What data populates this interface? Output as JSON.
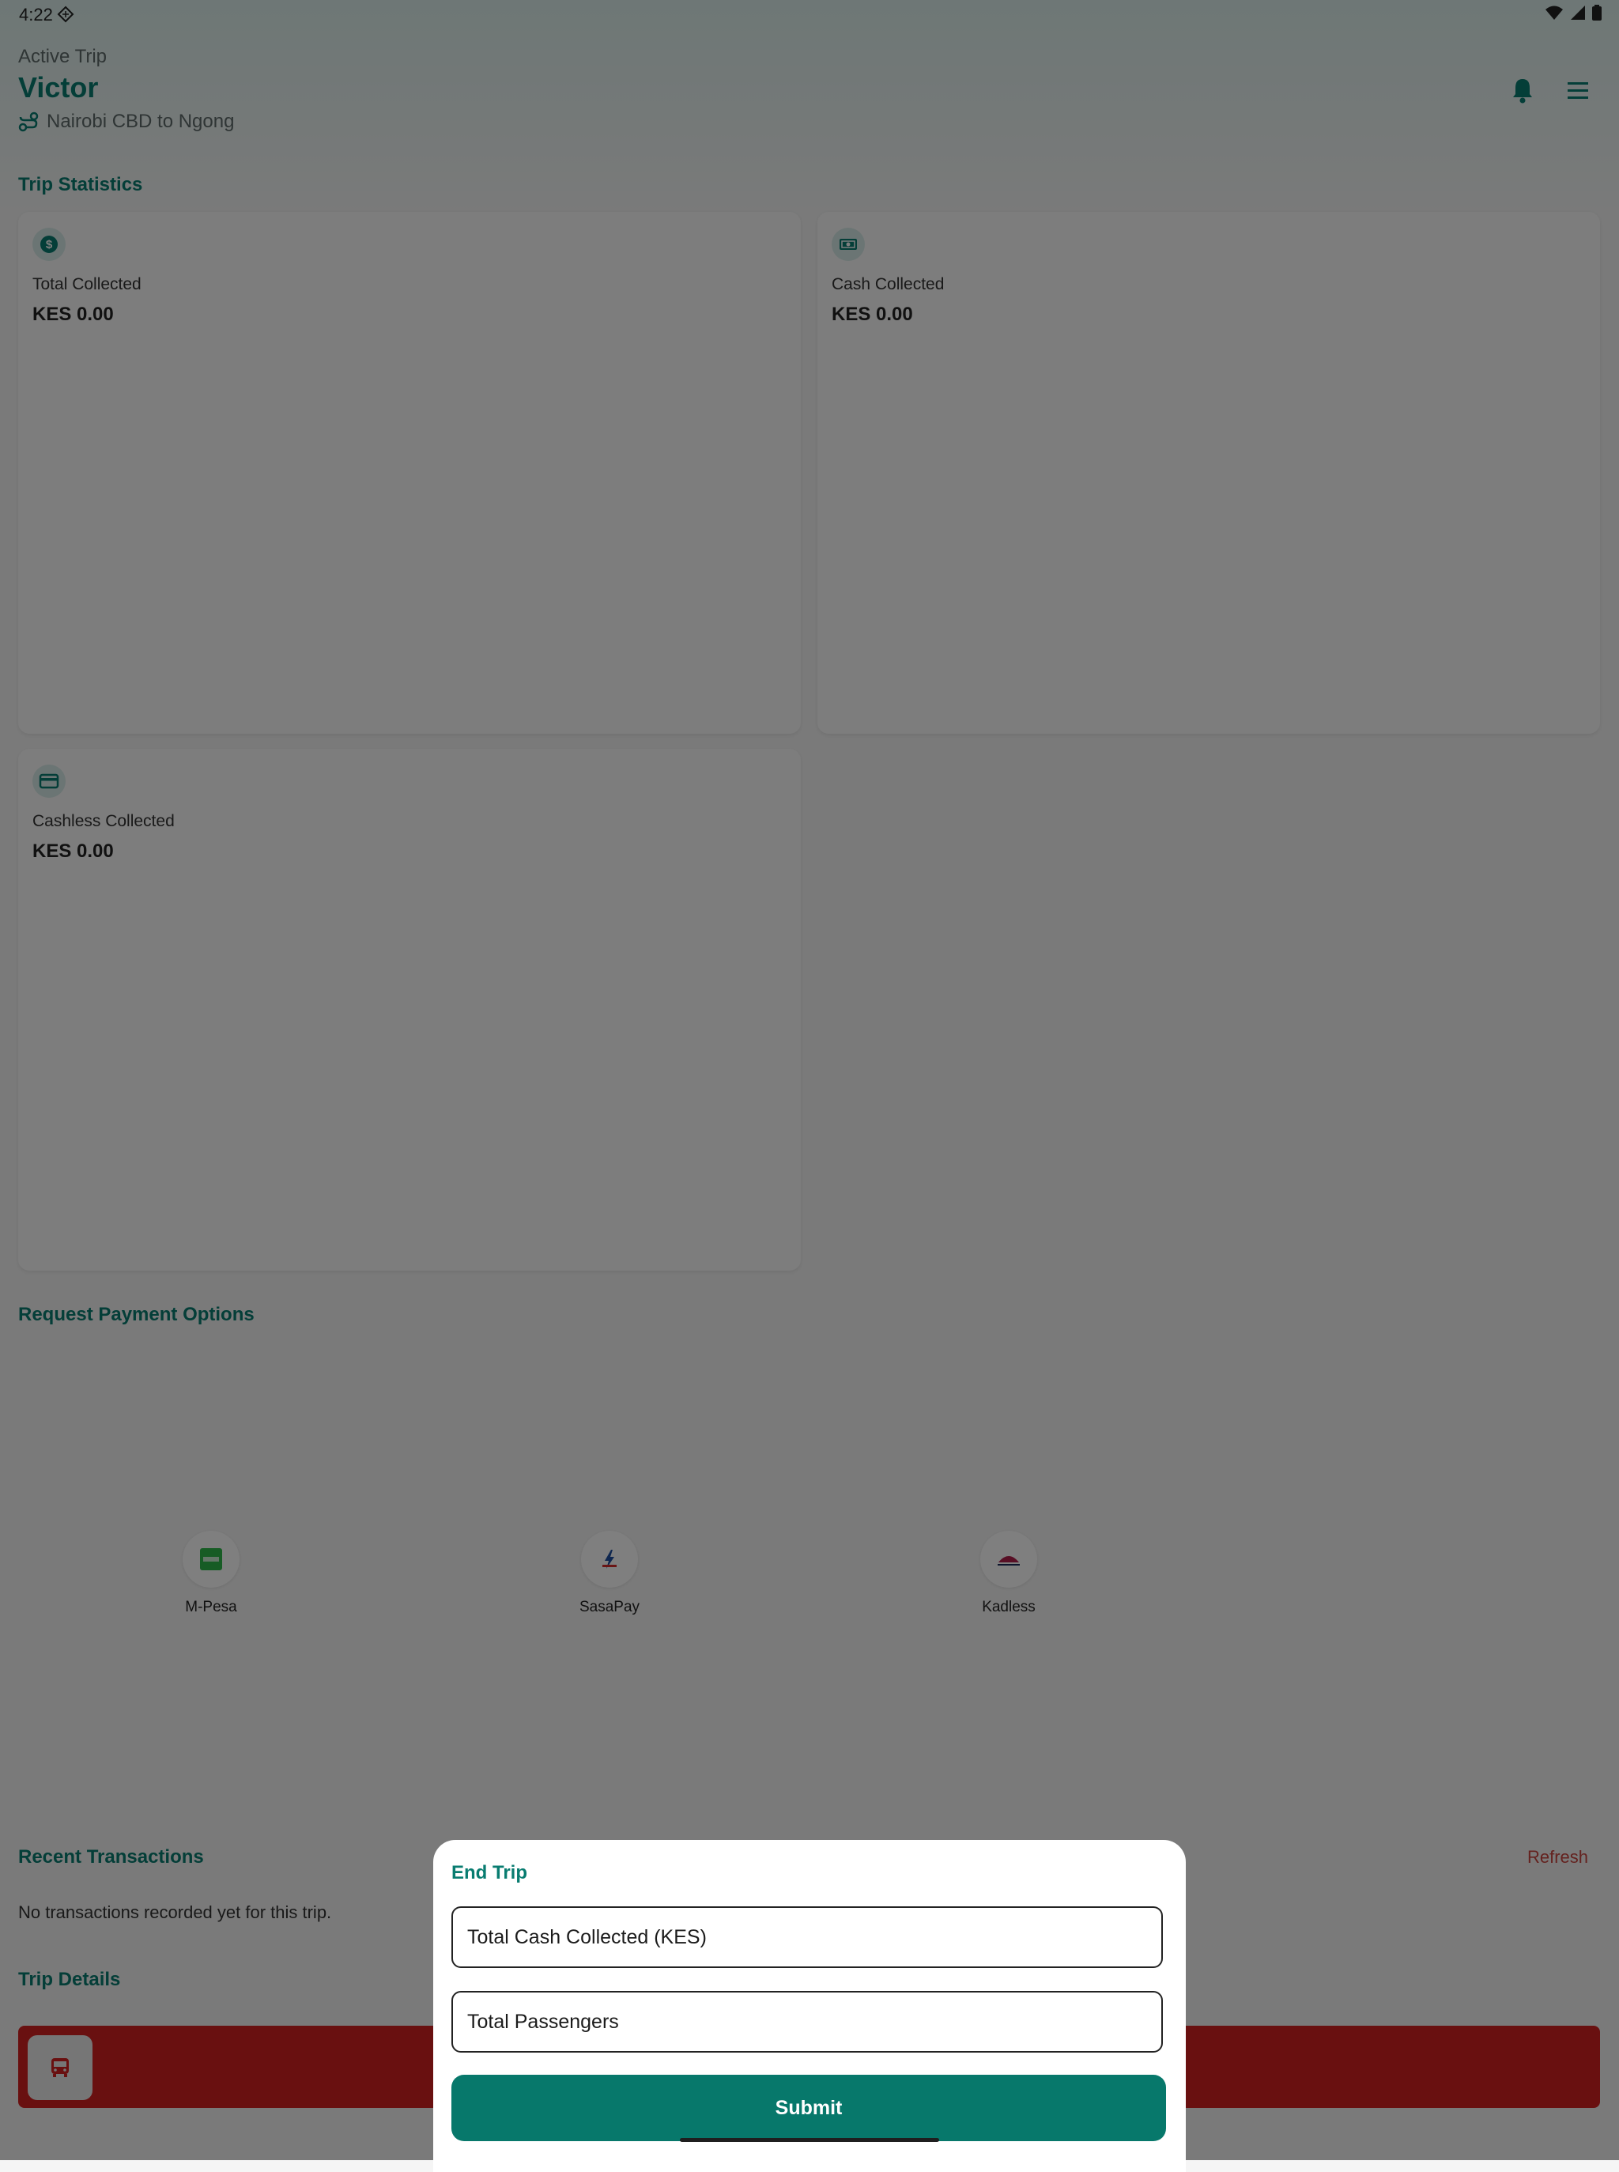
{
  "status_bar": {
    "time": "4:22"
  },
  "header": {
    "eyebrow": "Active Trip",
    "title": "Victor",
    "route": "Nairobi CBD to Ngong"
  },
  "stats": {
    "section_title": "Trip Statistics",
    "cards": [
      {
        "label": "Total Collected",
        "value": "KES 0.00",
        "icon": "dollar-circle-icon"
      },
      {
        "label": "Cash Collected",
        "value": "KES 0.00",
        "icon": "banknote-icon"
      },
      {
        "label": "Cashless Collected",
        "value": "KES 0.00",
        "icon": "credit-card-icon"
      }
    ]
  },
  "payment_options": {
    "section_title": "Request Payment Options",
    "items": [
      {
        "label": "M-Pesa",
        "icon": "mpesa-logo"
      },
      {
        "label": "SasaPay",
        "icon": "sasapay-logo"
      },
      {
        "label": "Kadless",
        "icon": "kadless-logo"
      }
    ]
  },
  "transactions": {
    "section_title": "Recent Transactions",
    "refresh_label": "Refresh",
    "empty_text": "No transactions recorded yet for this trip."
  },
  "trip_details": {
    "section_title": "Trip Details"
  },
  "end_trip_sheet": {
    "title": "End Trip",
    "cash_field_placeholder": "Total Cash Collected (KES)",
    "passengers_field_placeholder": "Total Passengers",
    "submit_label": "Submit"
  },
  "colors": {
    "accent": "#087c70",
    "button": "#07786b",
    "danger": "#d32020",
    "refresh": "#c8453f"
  }
}
